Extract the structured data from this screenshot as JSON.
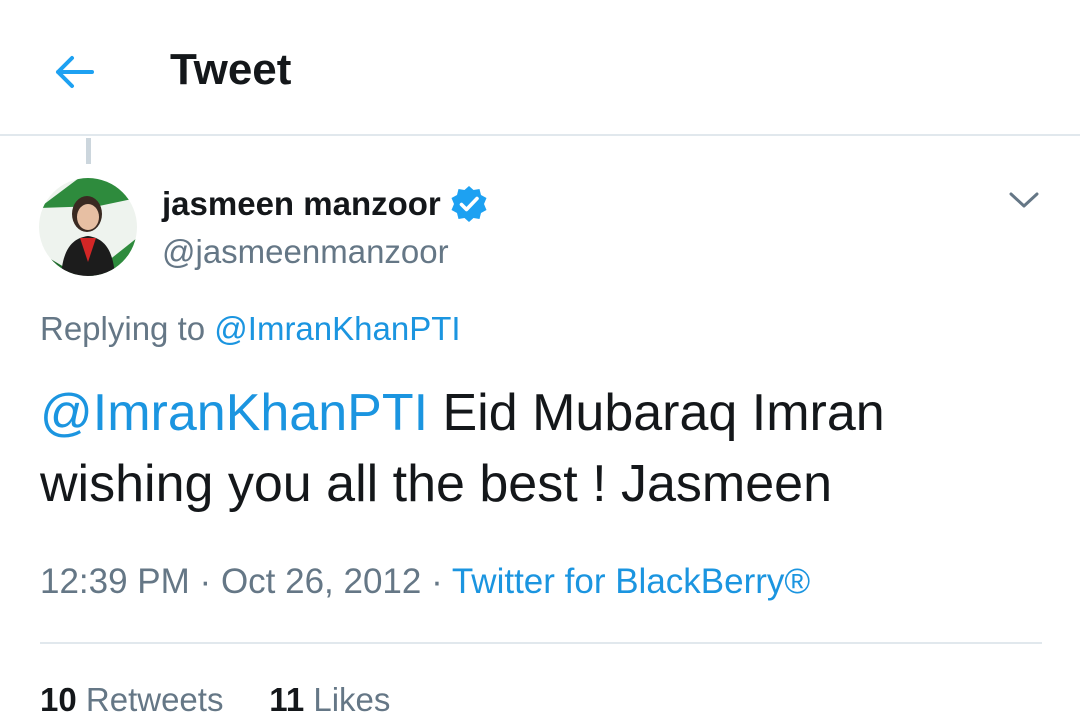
{
  "header": {
    "title": "Tweet",
    "back_icon": "arrow-left-icon",
    "accent_color": "#1da1f2"
  },
  "tweet": {
    "author": {
      "name": "jasmeen manzoor",
      "handle": "@jasmeenmanzoor",
      "verified": true,
      "avatar_icon": "profile-photo"
    },
    "replying_prefix": "Replying to",
    "replying_to": "@ImranKhanPTI",
    "text_mention": "@ImranKhanPTI",
    "text_body": " Eid Mubaraq Imran wishing you all the best ! Jasmeen",
    "time": "12:39 PM",
    "date": "Oct 26, 2012",
    "separator": "·",
    "source": "Twitter for BlackBerry®",
    "more_icon": "chevron-down-icon"
  },
  "stats": {
    "retweets_count": "10",
    "retweets_label": "Retweets",
    "likes_count": "11",
    "likes_label": "Likes"
  }
}
